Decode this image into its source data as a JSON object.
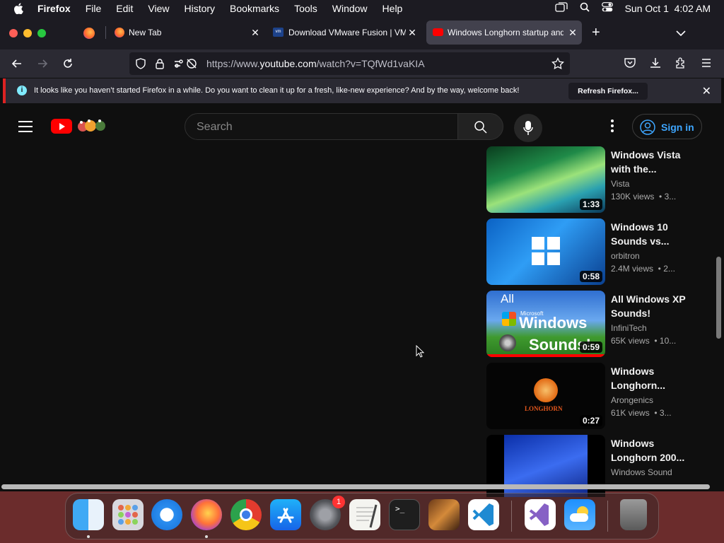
{
  "menubar": {
    "apple_icon": "apple-icon",
    "items": [
      "Firefox",
      "File",
      "Edit",
      "View",
      "History",
      "Bookmarks",
      "Tools",
      "Window",
      "Help"
    ],
    "datetime": "Sun Oct 1  4:02 AM"
  },
  "tabs": [
    {
      "label": "New Tab"
    },
    {
      "label": "Download VMware Fusion | VMw"
    },
    {
      "label": "Windows Longhorn startup and"
    }
  ],
  "navbar": {
    "url_prefix": "https://www.",
    "url_domain": "youtube.com",
    "url_path": "/watch?v=TQfWd1vaKIA"
  },
  "infobar": {
    "message": "It looks like you haven’t started Firefox in a while. Do you want to clean it up for a fresh, like-new experience? And by the way, welcome back!",
    "button": "Refresh Firefox..."
  },
  "youtube": {
    "search_placeholder": "Search",
    "signin": "Sign in",
    "videos": [
      {
        "title": "Windows Vista with the...",
        "channel": "Vista",
        "meta": "130K views  • 3...",
        "duration": "1:33"
      },
      {
        "title": "Windows 10 Sounds vs...",
        "channel": "orbitron",
        "meta": "2.4M views  • 2...",
        "duration": "0:58"
      },
      {
        "title": "All Windows XP Sounds!",
        "channel": "InfiniTech",
        "meta": "65K views  • 10...",
        "duration": "0:59",
        "thumb_text": [
          "All",
          "Windows",
          "Sounds!",
          "Microsoft"
        ],
        "watched_fraction": 1.0
      },
      {
        "title": "Windows Longhorn...",
        "channel": "Arongenics",
        "meta": "61K views  • 3...",
        "duration": "0:27",
        "thumb_text": [
          "LONGHORN"
        ]
      },
      {
        "title": "Windows Longhorn 200...",
        "channel": "Windows Sound",
        "meta": "",
        "duration": ""
      }
    ]
  },
  "dock": {
    "apps": [
      "Finder",
      "Launchpad",
      "Safari",
      "Firefox",
      "Chrome",
      "App Store",
      "System Settings",
      "TextEdit",
      "Terminal",
      "GarageBand",
      "VS Code",
      "Visual Studio",
      "Weather",
      "Trash"
    ],
    "settings_badge": "1"
  }
}
